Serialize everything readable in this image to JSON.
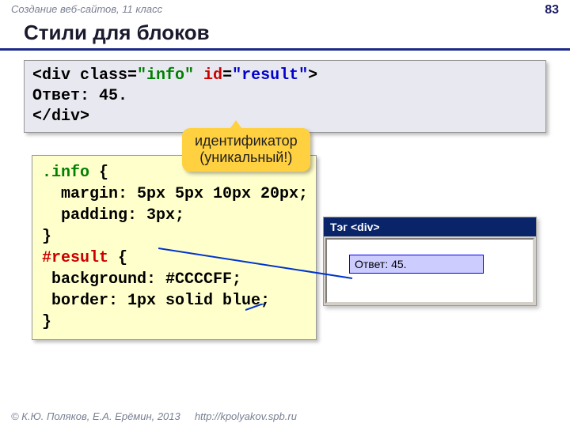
{
  "header": {
    "course": "Создание веб-сайтов, 11 класс",
    "page": "83"
  },
  "title": "Стили для блоков",
  "html_code": {
    "l1_open": "<div class=",
    "l1_class_val": "\"info\"",
    "l1_id_key": " id",
    "l1_eq": "=",
    "l1_id_val": "\"result\"",
    "l1_close": ">",
    "l2": "Ответ: 45.",
    "l3": "</div>"
  },
  "callout": {
    "line1": "идентификатор",
    "line2": "(уникальный!)"
  },
  "css_code": {
    "sel1": ".info",
    "brace_o": " {",
    "rule1": "  margin: 5px 5px 10px 20px;",
    "rule2": "  padding: 3px;",
    "brace_c1": "}",
    "sel2": "#result",
    "brace_o2": " {",
    "rule3": " background: #CCCCFF;",
    "rule4": " border: 1px solid blue;",
    "brace_c2": "}"
  },
  "preview": {
    "title": "Тэг <div>",
    "body": "Ответ: 45."
  },
  "footer": {
    "copyright": "© К.Ю. Поляков, Е.А. Ерёмин, 2013",
    "url": "http://kpolyakov.spb.ru"
  }
}
